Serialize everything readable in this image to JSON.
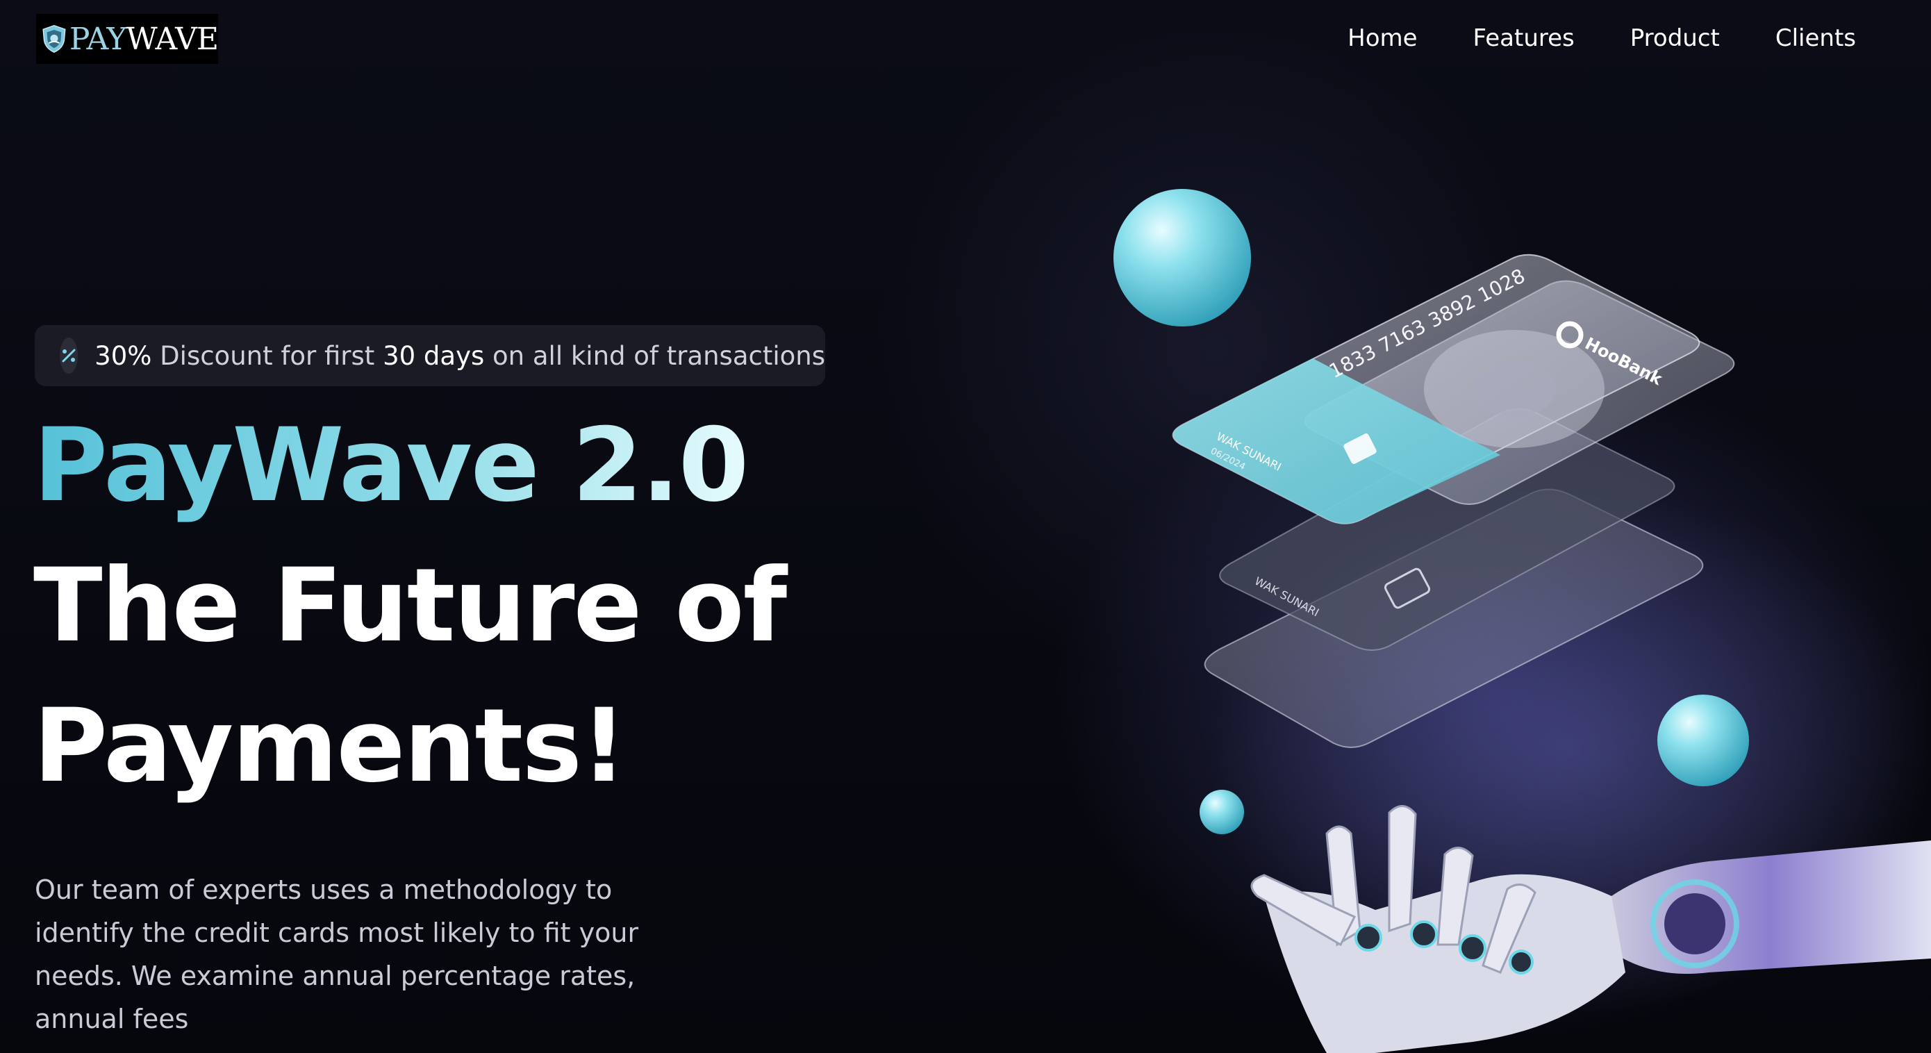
{
  "brand": {
    "logo_pay": "PAY",
    "logo_wave": "WAVE"
  },
  "nav": {
    "items": [
      {
        "label": "Home"
      },
      {
        "label": "Features"
      },
      {
        "label": "Product"
      },
      {
        "label": "Clients"
      }
    ]
  },
  "promo": {
    "discount": "30%",
    "text1": " Discount for first ",
    "days": "30 days",
    "text2": " on all kind of transactions"
  },
  "hero": {
    "brand_title": "PayWave 2.0",
    "line1": "The Future of",
    "line2": "Payments!",
    "description": "Our team of experts uses a methodology to identify the credit cards most likely to fit your needs. We examine annual percentage rates, annual fees"
  },
  "card": {
    "number": "1833 7163 3892 1028",
    "bank": "HooBank",
    "holder": "WAK SUNARI",
    "expiry": "06/2024"
  },
  "colors": {
    "accent": "#5fc7dc",
    "background": "#07080f"
  }
}
